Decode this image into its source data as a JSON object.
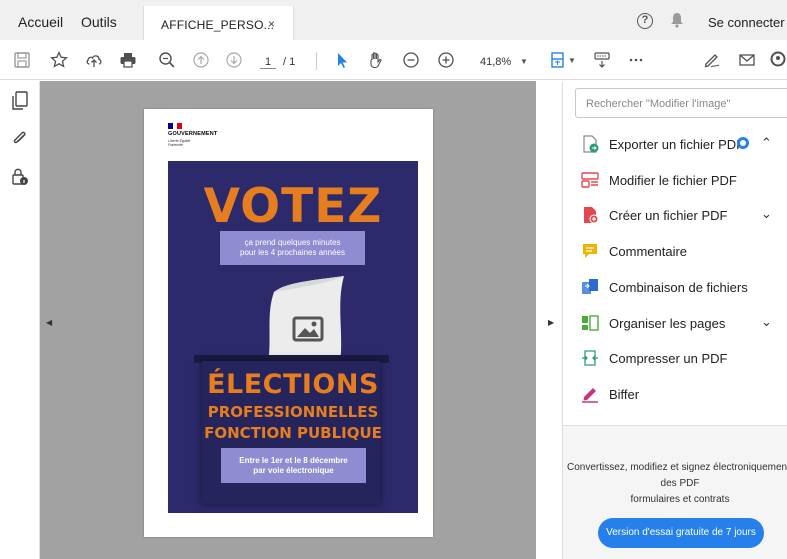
{
  "menubar": {
    "home": "Accueil",
    "tools": "Outils",
    "tab_title": "AFFICHE_PERSO...",
    "tab_close": "×",
    "help": "?",
    "connect": "Se connecter"
  },
  "toolbar": {
    "page_current": "1",
    "page_total": "/ 1",
    "zoom": "41,8%",
    "zoom_caret": "▼"
  },
  "viewer": {
    "collapse_left": "◀",
    "collapse_right": "▶"
  },
  "poster": {
    "gov": "GOUVERNEMENT",
    "motto": "Liberté Égalité Fraternité",
    "votez": "VOTEZ",
    "note_line1": "ça prend quelques minutes",
    "note_line2": "pour les 4 prochaines années",
    "elections": "ÉLECTIONS",
    "pro": "PROFESSIONNELLES",
    "fonction": "FONCTION PUBLIQUE",
    "date_line1": "Entre le 1er et le 8 décembre",
    "date_line2": "par voie électronique",
    "colors": {
      "navy": "#2c2a6b",
      "orange": "#e67e1f",
      "lilac": "#8f8cd2"
    }
  },
  "rightpane": {
    "search_placeholder": "Rechercher \"Modifier l'image\"",
    "tools": [
      {
        "label": "Exporter un fichier PDF",
        "icon": "export-pdf-icon",
        "chevron": "⌃"
      },
      {
        "label": "Modifier le fichier PDF",
        "icon": "edit-pdf-icon",
        "chevron": ""
      },
      {
        "label": "Créer un fichier PDF",
        "icon": "create-pdf-icon",
        "chevron": "⌄"
      },
      {
        "label": "Commentaire",
        "icon": "comment-icon",
        "chevron": ""
      },
      {
        "label": "Combinaison de fichiers",
        "icon": "combine-files-icon",
        "chevron": ""
      },
      {
        "label": "Organiser les pages",
        "icon": "organize-pages-icon",
        "chevron": "⌄"
      },
      {
        "label": "Compresser un PDF",
        "icon": "compress-pdf-icon",
        "chevron": ""
      },
      {
        "label": "Biffer",
        "icon": "redact-icon",
        "chevron": ""
      }
    ],
    "promo_line1": "Convertissez, modifiez et signez électroniquement",
    "promo_line2": "des PDF",
    "promo_line3": "formulaires et contrats",
    "trial_button": "Version d'essai gratuite de 7 jours"
  }
}
